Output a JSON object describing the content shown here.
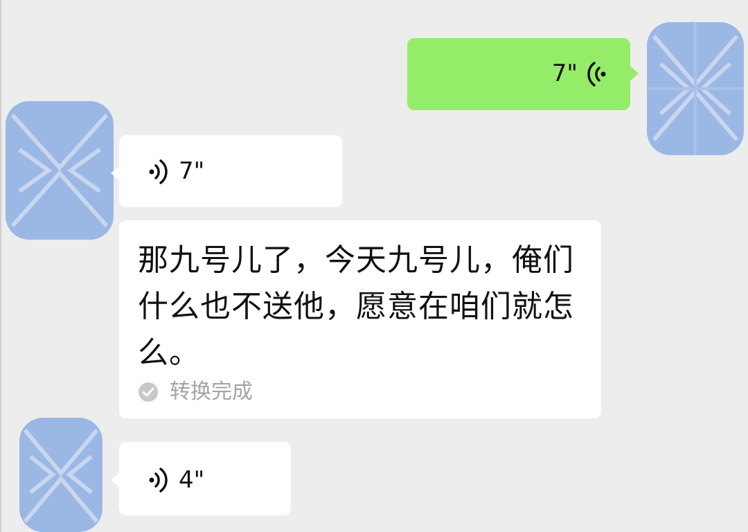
{
  "colors": {
    "background": "#ededed",
    "sent_bubble": "#95ec69",
    "received_bubble": "#ffffff",
    "avatar_redaction": "#9bb7e4",
    "status_text": "#a3a3a3"
  },
  "messages": [
    {
      "direction": "sent",
      "type": "voice",
      "duration": "7\"",
      "icon": "voice-wave-icon"
    },
    {
      "direction": "received",
      "type": "voice",
      "duration": "7\"",
      "icon": "voice-wave-icon",
      "transcript": {
        "text": "那九号儿了，今天九号儿，俺们什么也不送他，愿意在咱们就怎么。",
        "status": "转换完成",
        "status_icon": "check-circle-icon"
      }
    },
    {
      "direction": "received",
      "type": "voice",
      "duration": "4\"",
      "icon": "voice-wave-icon"
    }
  ]
}
